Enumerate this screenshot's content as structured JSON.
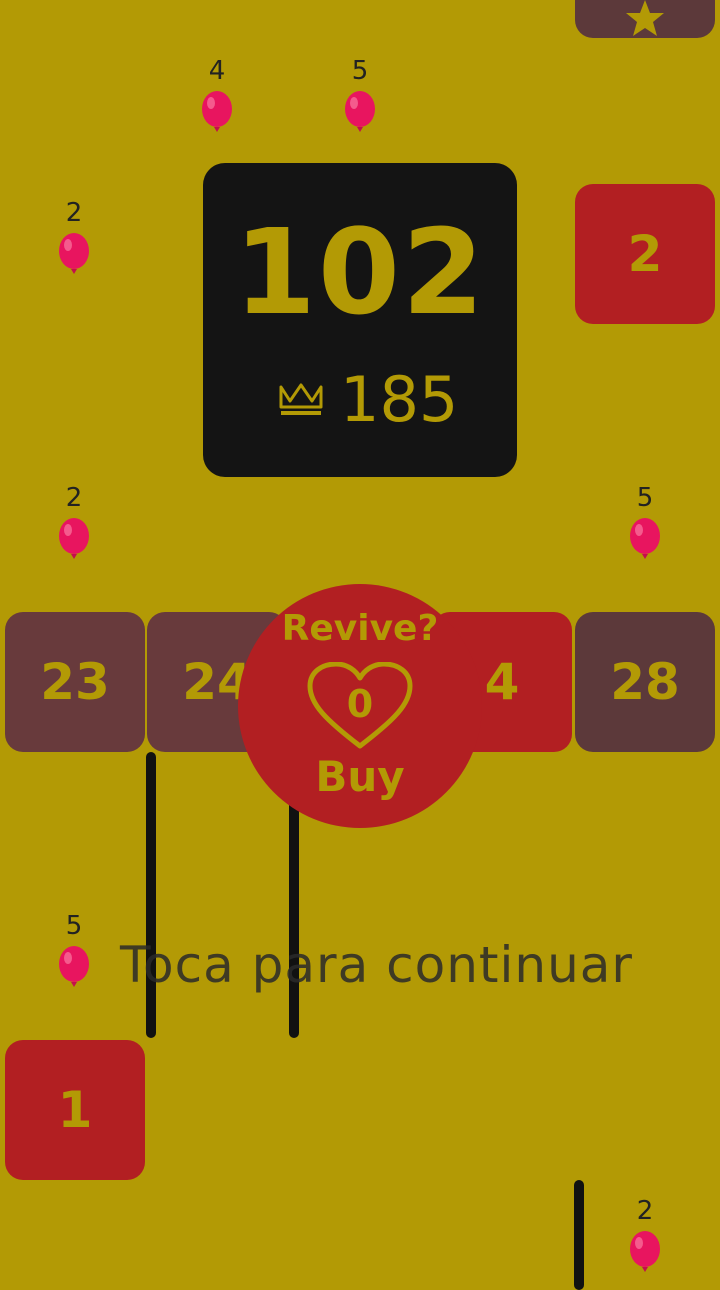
{
  "score": {
    "current": "102",
    "best": "185",
    "best_icon": "crown-icon"
  },
  "revive": {
    "title": "Revive?",
    "count": "0",
    "buy_label": "Buy",
    "icon": "heart-icon"
  },
  "prompt": "Toca para continuar",
  "top_tab_icon": "star-icon",
  "tiles": [
    {
      "value": "2"
    },
    {
      "value": "23"
    },
    {
      "value": "24"
    },
    {
      "value": "4"
    },
    {
      "value": "28"
    },
    {
      "value": "1"
    }
  ],
  "balloons": [
    {
      "value": "4"
    },
    {
      "value": "5"
    },
    {
      "value": "2"
    },
    {
      "value": "2"
    },
    {
      "value": "5"
    },
    {
      "value": "5"
    },
    {
      "value": "2"
    }
  ],
  "colors": {
    "background": "#b39a05",
    "tile_red": "#b21f22",
    "tile_brown": "#5c393a",
    "scoreboard": "#141414",
    "balloon": "#e8155f"
  }
}
